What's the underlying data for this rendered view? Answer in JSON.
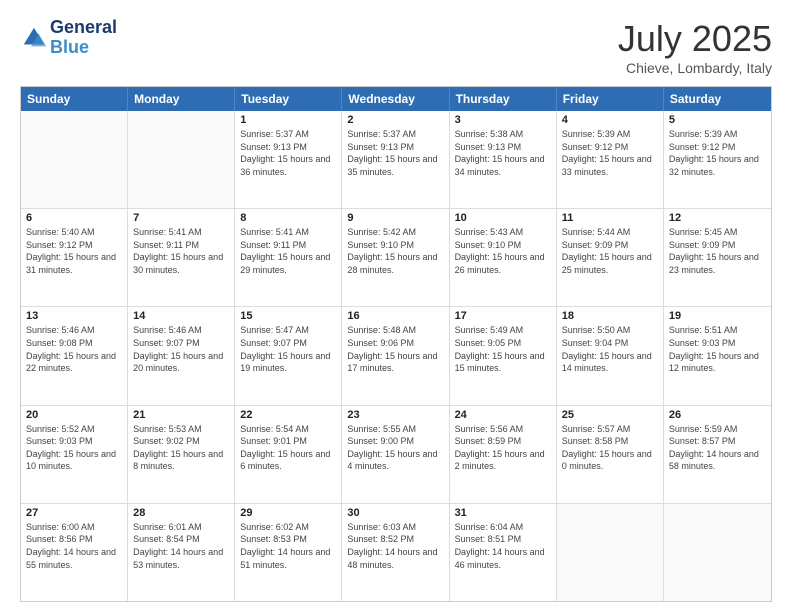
{
  "header": {
    "logo_line1": "General",
    "logo_line2": "Blue",
    "month_title": "July 2025",
    "location": "Chieve, Lombardy, Italy"
  },
  "weekdays": [
    "Sunday",
    "Monday",
    "Tuesday",
    "Wednesday",
    "Thursday",
    "Friday",
    "Saturday"
  ],
  "weeks": [
    [
      {
        "day": "",
        "sunrise": "",
        "sunset": "",
        "daylight": ""
      },
      {
        "day": "",
        "sunrise": "",
        "sunset": "",
        "daylight": ""
      },
      {
        "day": "1",
        "sunrise": "Sunrise: 5:37 AM",
        "sunset": "Sunset: 9:13 PM",
        "daylight": "Daylight: 15 hours and 36 minutes."
      },
      {
        "day": "2",
        "sunrise": "Sunrise: 5:37 AM",
        "sunset": "Sunset: 9:13 PM",
        "daylight": "Daylight: 15 hours and 35 minutes."
      },
      {
        "day": "3",
        "sunrise": "Sunrise: 5:38 AM",
        "sunset": "Sunset: 9:13 PM",
        "daylight": "Daylight: 15 hours and 34 minutes."
      },
      {
        "day": "4",
        "sunrise": "Sunrise: 5:39 AM",
        "sunset": "Sunset: 9:12 PM",
        "daylight": "Daylight: 15 hours and 33 minutes."
      },
      {
        "day": "5",
        "sunrise": "Sunrise: 5:39 AM",
        "sunset": "Sunset: 9:12 PM",
        "daylight": "Daylight: 15 hours and 32 minutes."
      }
    ],
    [
      {
        "day": "6",
        "sunrise": "Sunrise: 5:40 AM",
        "sunset": "Sunset: 9:12 PM",
        "daylight": "Daylight: 15 hours and 31 minutes."
      },
      {
        "day": "7",
        "sunrise": "Sunrise: 5:41 AM",
        "sunset": "Sunset: 9:11 PM",
        "daylight": "Daylight: 15 hours and 30 minutes."
      },
      {
        "day": "8",
        "sunrise": "Sunrise: 5:41 AM",
        "sunset": "Sunset: 9:11 PM",
        "daylight": "Daylight: 15 hours and 29 minutes."
      },
      {
        "day": "9",
        "sunrise": "Sunrise: 5:42 AM",
        "sunset": "Sunset: 9:10 PM",
        "daylight": "Daylight: 15 hours and 28 minutes."
      },
      {
        "day": "10",
        "sunrise": "Sunrise: 5:43 AM",
        "sunset": "Sunset: 9:10 PM",
        "daylight": "Daylight: 15 hours and 26 minutes."
      },
      {
        "day": "11",
        "sunrise": "Sunrise: 5:44 AM",
        "sunset": "Sunset: 9:09 PM",
        "daylight": "Daylight: 15 hours and 25 minutes."
      },
      {
        "day": "12",
        "sunrise": "Sunrise: 5:45 AM",
        "sunset": "Sunset: 9:09 PM",
        "daylight": "Daylight: 15 hours and 23 minutes."
      }
    ],
    [
      {
        "day": "13",
        "sunrise": "Sunrise: 5:46 AM",
        "sunset": "Sunset: 9:08 PM",
        "daylight": "Daylight: 15 hours and 22 minutes."
      },
      {
        "day": "14",
        "sunrise": "Sunrise: 5:46 AM",
        "sunset": "Sunset: 9:07 PM",
        "daylight": "Daylight: 15 hours and 20 minutes."
      },
      {
        "day": "15",
        "sunrise": "Sunrise: 5:47 AM",
        "sunset": "Sunset: 9:07 PM",
        "daylight": "Daylight: 15 hours and 19 minutes."
      },
      {
        "day": "16",
        "sunrise": "Sunrise: 5:48 AM",
        "sunset": "Sunset: 9:06 PM",
        "daylight": "Daylight: 15 hours and 17 minutes."
      },
      {
        "day": "17",
        "sunrise": "Sunrise: 5:49 AM",
        "sunset": "Sunset: 9:05 PM",
        "daylight": "Daylight: 15 hours and 15 minutes."
      },
      {
        "day": "18",
        "sunrise": "Sunrise: 5:50 AM",
        "sunset": "Sunset: 9:04 PM",
        "daylight": "Daylight: 15 hours and 14 minutes."
      },
      {
        "day": "19",
        "sunrise": "Sunrise: 5:51 AM",
        "sunset": "Sunset: 9:03 PM",
        "daylight": "Daylight: 15 hours and 12 minutes."
      }
    ],
    [
      {
        "day": "20",
        "sunrise": "Sunrise: 5:52 AM",
        "sunset": "Sunset: 9:03 PM",
        "daylight": "Daylight: 15 hours and 10 minutes."
      },
      {
        "day": "21",
        "sunrise": "Sunrise: 5:53 AM",
        "sunset": "Sunset: 9:02 PM",
        "daylight": "Daylight: 15 hours and 8 minutes."
      },
      {
        "day": "22",
        "sunrise": "Sunrise: 5:54 AM",
        "sunset": "Sunset: 9:01 PM",
        "daylight": "Daylight: 15 hours and 6 minutes."
      },
      {
        "day": "23",
        "sunrise": "Sunrise: 5:55 AM",
        "sunset": "Sunset: 9:00 PM",
        "daylight": "Daylight: 15 hours and 4 minutes."
      },
      {
        "day": "24",
        "sunrise": "Sunrise: 5:56 AM",
        "sunset": "Sunset: 8:59 PM",
        "daylight": "Daylight: 15 hours and 2 minutes."
      },
      {
        "day": "25",
        "sunrise": "Sunrise: 5:57 AM",
        "sunset": "Sunset: 8:58 PM",
        "daylight": "Daylight: 15 hours and 0 minutes."
      },
      {
        "day": "26",
        "sunrise": "Sunrise: 5:59 AM",
        "sunset": "Sunset: 8:57 PM",
        "daylight": "Daylight: 14 hours and 58 minutes."
      }
    ],
    [
      {
        "day": "27",
        "sunrise": "Sunrise: 6:00 AM",
        "sunset": "Sunset: 8:56 PM",
        "daylight": "Daylight: 14 hours and 55 minutes."
      },
      {
        "day": "28",
        "sunrise": "Sunrise: 6:01 AM",
        "sunset": "Sunset: 8:54 PM",
        "daylight": "Daylight: 14 hours and 53 minutes."
      },
      {
        "day": "29",
        "sunrise": "Sunrise: 6:02 AM",
        "sunset": "Sunset: 8:53 PM",
        "daylight": "Daylight: 14 hours and 51 minutes."
      },
      {
        "day": "30",
        "sunrise": "Sunrise: 6:03 AM",
        "sunset": "Sunset: 8:52 PM",
        "daylight": "Daylight: 14 hours and 48 minutes."
      },
      {
        "day": "31",
        "sunrise": "Sunrise: 6:04 AM",
        "sunset": "Sunset: 8:51 PM",
        "daylight": "Daylight: 14 hours and 46 minutes."
      },
      {
        "day": "",
        "sunrise": "",
        "sunset": "",
        "daylight": ""
      },
      {
        "day": "",
        "sunrise": "",
        "sunset": "",
        "daylight": ""
      }
    ]
  ]
}
